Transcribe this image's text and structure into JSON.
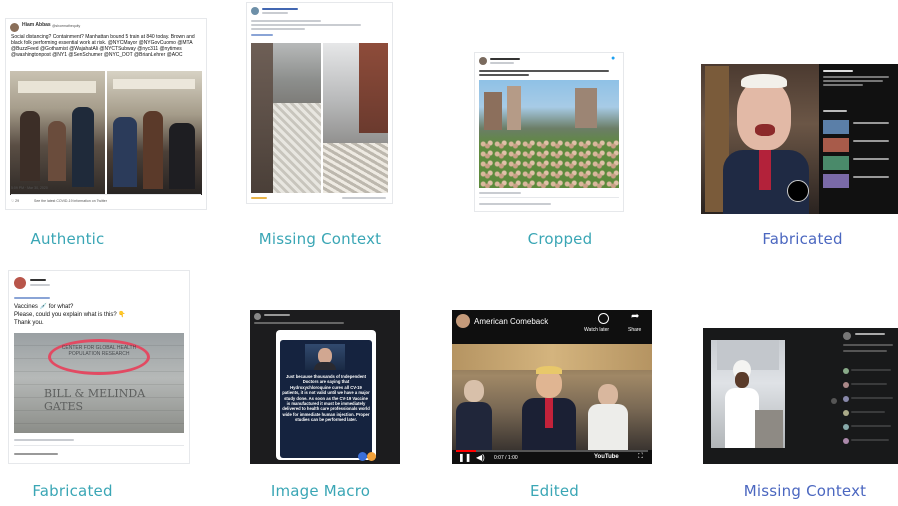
{
  "captions": {
    "t1": "Authentic",
    "t2": "Missing Context",
    "t3": "Cropped",
    "t4": "Fabricated",
    "t5": "Fabricated",
    "t6": "Image Macro",
    "t7": "Edited",
    "t8": "Missing Context"
  },
  "tweet1": {
    "author": "Hiam Abbas",
    "handle": "@shoemathequity",
    "text": "Social distancing? Containment? Manhattan bound 5 train at 840 today. Brown and black folk performing essential work at risk. @NYCMayor @NYGovCuomo @MTA @BuzzFeed @Gothamist @WajahatAli @NYCTSubway @nyc311 @nytimes @washingtonpost @NY1 @SenSchumer @NYC_DOT @BrianLehrer @AOC",
    "time": "5:09 PM · Mar 30, 2020",
    "likes": "29",
    "info": "See the latest COVID-19 information on Twitter"
  },
  "video": {
    "channel": "American Comeback",
    "watch_later": "Watch later",
    "share": "Share",
    "time": "0:07 / 1:00",
    "brand": "YouTube"
  },
  "tweet5": {
    "text": "Vaccines 💉 for what?\nPlease, could you explain what is this? 👇\nThank you.",
    "sign_top": "CENTER FOR GLOBAL HEALTH POPULATION RESEARCH",
    "sign_bottom": "BILL & MELINDA GATES"
  },
  "macro": {
    "text": "Just because thousands of Independent Doctors are saying that Hydroxychloroquine cures all CV-19 patients, it is not valid until we have a major study done. As soon as the CV-19 Vaccine is manufactured it must be immediately delivered to health care professionals world wide for immediate human injection. Proper studies can be performed later."
  },
  "colors": {
    "teal": "#3aa6b5",
    "blue": "#4b67c0"
  }
}
